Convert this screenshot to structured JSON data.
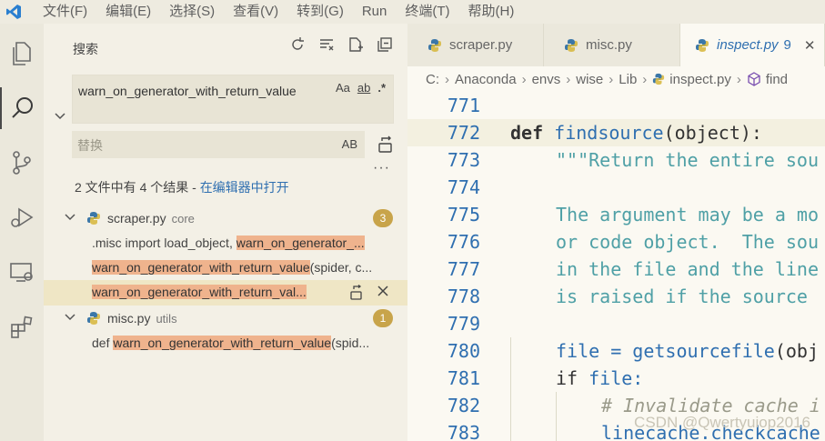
{
  "menu": [
    "文件(F)",
    "编辑(E)",
    "选择(S)",
    "查看(V)",
    "转到(G)",
    "Run",
    "终端(T)",
    "帮助(H)"
  ],
  "sidebar": {
    "title": "搜索",
    "search_value": "warn_on_generator_with_return_value",
    "opt_case": "Aa",
    "opt_word": "ab",
    "opt_regex": ".*",
    "replace_placeholder": "替换",
    "replace_opt": "AB",
    "more": "···",
    "summary_text": "2 文件中有 4 个结果 - ",
    "summary_link": "在编辑器中打开",
    "files": [
      {
        "name": "scraper.py",
        "dir": "core",
        "count": "3"
      },
      {
        "name": "misc.py",
        "dir": "utils",
        "count": "1"
      }
    ],
    "matches": {
      "m1_pre": ".misc import load_object, ",
      "m1_hl": "warn_on_generator_...",
      "m2_hl": "warn_on_generator_with_return_value",
      "m2_post": "(spider, c...",
      "m3_hl": "warn_on_generator_with_return_val...",
      "m4_pre": "def ",
      "m4_hl": "warn_on_generator_with_return_value",
      "m4_post": "(spid..."
    }
  },
  "tabs": [
    {
      "label": "scraper.py"
    },
    {
      "label": "misc.py"
    },
    {
      "label": "inspect.py",
      "count": "9",
      "close": "✕"
    }
  ],
  "breadcrumb": [
    "C:",
    "Anaconda",
    "envs",
    "wise",
    "Lib",
    "inspect.py",
    "find"
  ],
  "code": {
    "line_numbers": [
      "771",
      "772",
      "773",
      "774",
      "775",
      "776",
      "777",
      "778",
      "779",
      "780",
      "781",
      "782",
      "783"
    ],
    "l772_kw": "def",
    "l772_fn": "findsource",
    "l772_rest": "(object):",
    "l773": "\"\"\"Return the entire sou",
    "l775": "The argument may be a mo",
    "l776": "or code object.  The sou",
    "l777": "in the file and the line",
    "l778": "is raised if the source ",
    "l780_a": "file = ",
    "l780_fn": "getsourcefile",
    "l780_b": "(obj",
    "l781_kw": "if",
    "l781_b": " file:",
    "l782": "# Invalidate cache i",
    "l783_a": "linecache.",
    "l783_fn": "checkcache"
  },
  "watermark": "CSDN @Qwertyuiop2016"
}
